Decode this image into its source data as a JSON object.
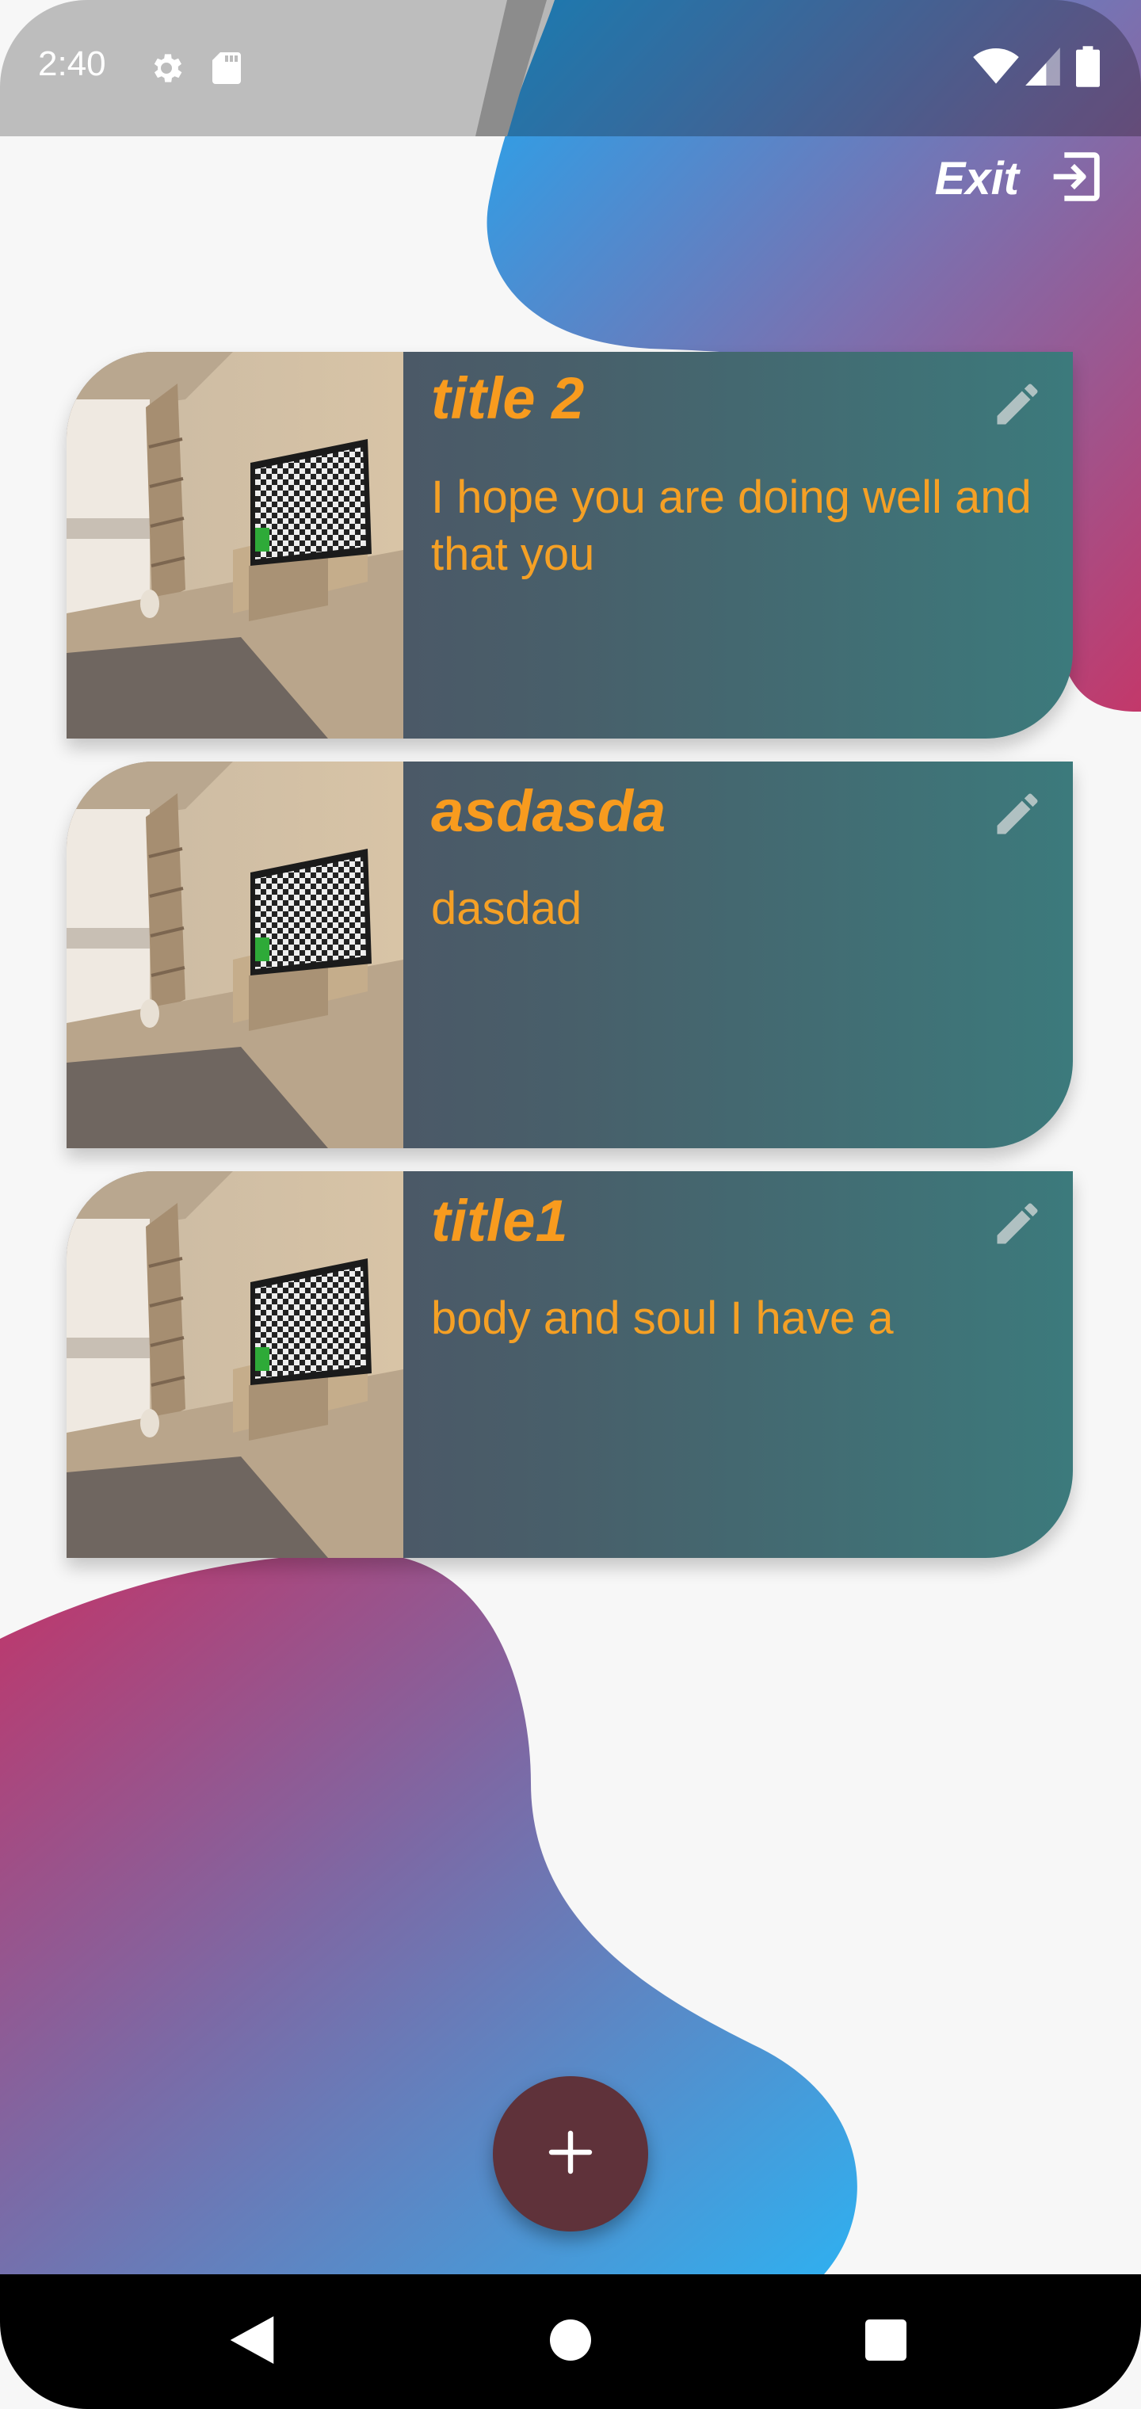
{
  "status_bar": {
    "time": "2:40",
    "left_icons": [
      "gear-icon",
      "sd-card-icon"
    ],
    "right_icons": [
      "wifi-icon",
      "signal-icon",
      "battery-icon"
    ]
  },
  "header": {
    "exit_label": "Exit",
    "exit_icon": "exit-icon"
  },
  "notes": [
    {
      "title": "title 2",
      "body": "I hope you are doing well and that you",
      "edit_icon": "pencil-icon"
    },
    {
      "title": "asdasda",
      "body": "dasdad",
      "edit_icon": "pencil-icon"
    },
    {
      "title": "title1",
      "body": "body and soul I have a",
      "edit_icon": "pencil-icon"
    }
  ],
  "fab": {
    "icon": "plus-icon",
    "label": "+"
  },
  "nav_bar": {
    "buttons": [
      "back-icon",
      "home-icon",
      "recents-icon"
    ]
  },
  "colors": {
    "background": "#f7f7f7",
    "blob_blue": "#30aaf0",
    "blob_pink": "#c3386a",
    "card_left": "#524c61",
    "card_right": "#3c7a7c",
    "accent_text": "#f89b1e",
    "fab": "#5f323a"
  }
}
